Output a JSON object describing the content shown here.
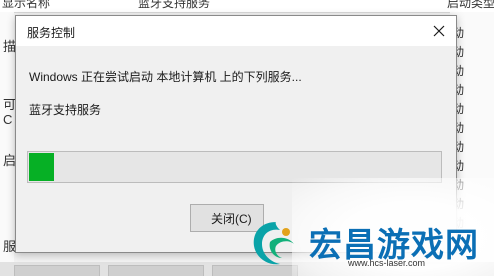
{
  "background_window": {
    "header_texts": [
      "显示名称",
      "蓝牙支持服务",
      "启动类型"
    ],
    "left_labels": [
      "描",
      "可",
      "C",
      "启",
      "服"
    ],
    "right_glyphs": [
      "动",
      "动",
      "动",
      "动",
      "动",
      "动",
      "动",
      "动",
      "动",
      "动",
      "动"
    ]
  },
  "dialog": {
    "title": "服务控制",
    "message": "Windows 正在尝试启动 本地计算机 上的下列服务...",
    "service_name": "蓝牙支持服务",
    "progress_fraction": 0.06,
    "progress_color": "#06b025",
    "close_button_label": "关闭(C)"
  },
  "watermark": {
    "title": "宏昌游戏网",
    "url": "www.hcs-laser.com",
    "color": "#0b6fb5"
  }
}
